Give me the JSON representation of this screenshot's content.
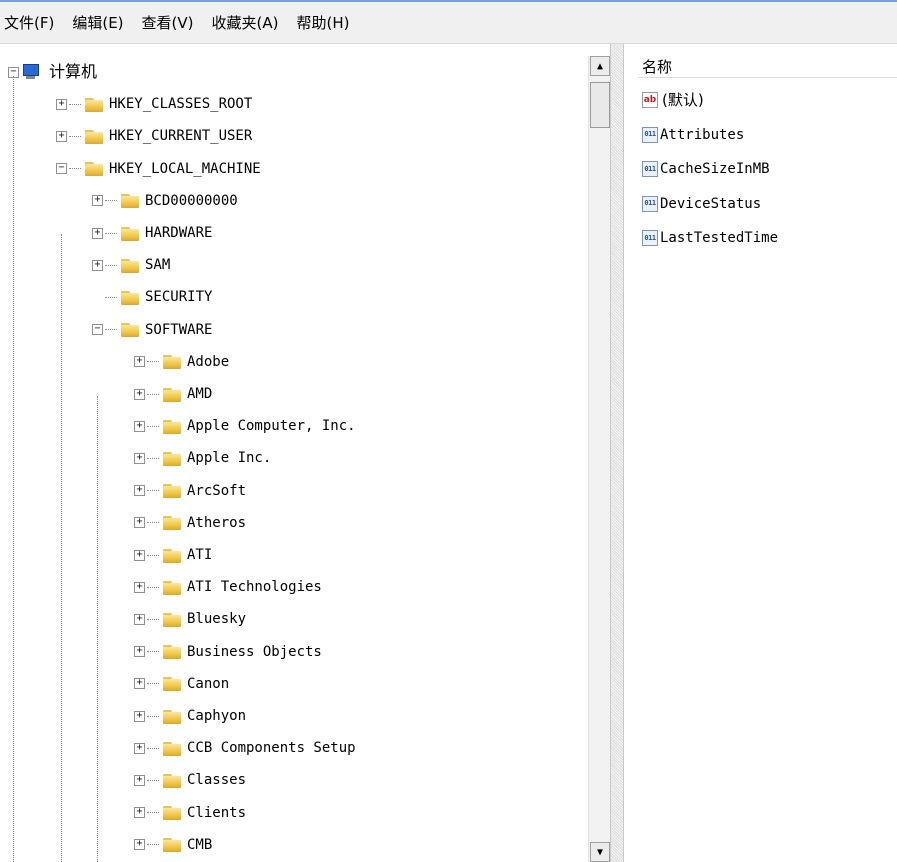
{
  "menu": [
    {
      "label": "文件(F)"
    },
    {
      "label": "编辑(E)"
    },
    {
      "label": "查看(V)"
    },
    {
      "label": "收藏夹(A)"
    },
    {
      "label": "帮助(H)"
    }
  ],
  "tree": {
    "root": {
      "label": "计算机",
      "icon": "computer-icon",
      "expander": "−"
    },
    "nodes": [
      {
        "label": "HKEY_CLASSES_ROOT",
        "level": 1,
        "expander": "+"
      },
      {
        "label": "HKEY_CURRENT_USER",
        "level": 1,
        "expander": "+"
      },
      {
        "label": "HKEY_LOCAL_MACHINE",
        "level": 1,
        "expander": "−"
      },
      {
        "label": "BCD00000000",
        "level": 2,
        "expander": "+"
      },
      {
        "label": "HARDWARE",
        "level": 2,
        "expander": "+"
      },
      {
        "label": "SAM",
        "level": 2,
        "expander": "+"
      },
      {
        "label": "SECURITY",
        "level": 2,
        "expander": ""
      },
      {
        "label": "SOFTWARE",
        "level": 2,
        "expander": "−"
      },
      {
        "label": "Adobe",
        "level": 3,
        "expander": "+"
      },
      {
        "label": "AMD",
        "level": 3,
        "expander": "+"
      },
      {
        "label": "Apple Computer, Inc.",
        "level": 3,
        "expander": "+"
      },
      {
        "label": "Apple Inc.",
        "level": 3,
        "expander": "+"
      },
      {
        "label": "ArcSoft",
        "level": 3,
        "expander": "+"
      },
      {
        "label": "Atheros",
        "level": 3,
        "expander": "+"
      },
      {
        "label": "ATI",
        "level": 3,
        "expander": "+"
      },
      {
        "label": "ATI Technologies",
        "level": 3,
        "expander": "+"
      },
      {
        "label": "Bluesky",
        "level": 3,
        "expander": "+"
      },
      {
        "label": "Business Objects",
        "level": 3,
        "expander": "+"
      },
      {
        "label": "Canon",
        "level": 3,
        "expander": "+"
      },
      {
        "label": "Caphyon",
        "level": 3,
        "expander": "+"
      },
      {
        "label": "CCB Components Setup",
        "level": 3,
        "expander": "+"
      },
      {
        "label": "Classes",
        "level": 3,
        "expander": "+"
      },
      {
        "label": "Clients",
        "level": 3,
        "expander": "+"
      },
      {
        "label": "CMB",
        "level": 3,
        "expander": "+"
      }
    ]
  },
  "values_pane": {
    "column_header": "名称",
    "rows": [
      {
        "name": "(默认)",
        "icon": "string-value-icon",
        "icon_text": "ab"
      },
      {
        "name": "Attributes",
        "icon": "binary-value-icon",
        "icon_text": "011"
      },
      {
        "name": "CacheSizeInMB",
        "icon": "binary-value-icon",
        "icon_text": "011"
      },
      {
        "name": "DeviceStatus",
        "icon": "binary-value-icon",
        "icon_text": "011"
      },
      {
        "name": "LastTestedTime",
        "icon": "binary-value-icon",
        "icon_text": "011"
      }
    ]
  },
  "scrollbar": {
    "up_arrow": "▲",
    "down_arrow": "▼"
  },
  "colors": {
    "menubar_bg": "#f0f0f0",
    "window_accent": "#7aa0d6",
    "folder": "#f2c94c"
  }
}
